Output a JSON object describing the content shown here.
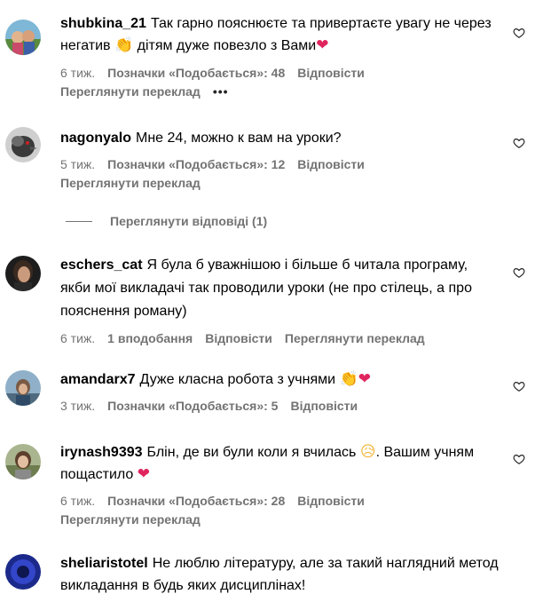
{
  "comments": [
    {
      "username": "shubkina_21",
      "text_a": "Так гарно пояснюєте та привертаєте увагу не через негатив ",
      "emoji_a": "👏",
      "text_b": " дітям дуже повезло з Вами",
      "emoji_b": "❤",
      "time": "6 тиж.",
      "likes": "Позначки «Подобається»: 48",
      "reply": "Відповісти",
      "translate": "Переглянути переклад",
      "more": "•••"
    },
    {
      "username": "nagonyalo",
      "text_a": "Мне 24, можно к вам на уроки?",
      "time": "5 тиж.",
      "likes": "Позначки «Подобається»: 12",
      "reply": "Відповісти",
      "translate": "Переглянути переклад"
    },
    {
      "username": "eschers_cat",
      "text_a": "Я була б уважнішою і більше б читала програму, якби мої викладачі так проводили уроки (не про стілець, а про пояснення роману)",
      "time": "6 тиж.",
      "likes": "1 вподобання",
      "reply": "Відповісти",
      "translate": "Переглянути переклад"
    },
    {
      "username": "amandarx7",
      "text_a": "Дуже класна робота з учнями ",
      "emoji_a": "👏",
      "emoji_b": "❤",
      "time": "3 тиж.",
      "likes": "Позначки «Подобається»: 5",
      "reply": "Відповісти"
    },
    {
      "username": "irynash9393",
      "text_a": "Блін, де ви були коли я вчилась ",
      "emoji_a": "😥",
      "text_b": ". Вашим учням пощастило ",
      "emoji_b": "❤",
      "time": "6 тиж.",
      "likes": "Позначки «Подобається»: 28",
      "reply": "Відповісти",
      "translate": "Переглянути переклад"
    },
    {
      "username": "sheliaristotel",
      "text_a": "Не люблю літературу, але за такий наглядний метод викладання в будь яких дисциплінах!"
    }
  ],
  "view_replies": "Переглянути відповіді (1)",
  "colors": {
    "secondary_text": "#737373",
    "heart_red": "#e0245e",
    "primary_text": "#000000"
  },
  "icons": {
    "like": "heart-outline-icon",
    "more": "more-horizontal-icon"
  }
}
